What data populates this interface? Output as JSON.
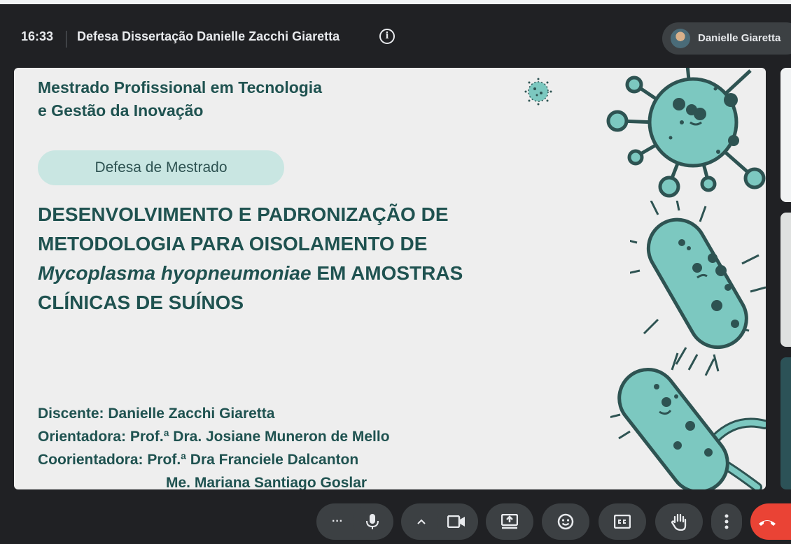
{
  "header": {
    "time": "16:33",
    "meeting_title": "Defesa Dissertação Danielle Zacchi Giaretta",
    "info_glyph": "i",
    "presenter_name": "Danielle Giaretta"
  },
  "slide": {
    "program_line1": "Mestrado Profissional em Tecnologia",
    "program_line2": "e Gestão da Inovação",
    "badge": "Defesa de Mestrado",
    "title_line1": "DESENVOLVIMENTO E PADRONIZAÇÃO DE",
    "title_line2": "METODOLOGIA PARA OISOLAMENTO DE",
    "title_italic": "Mycoplasma hyopneumoniae",
    "title_line3_rest": " EM AMOSTRAS",
    "title_line4": "CLÍNICAS DE SUÍNOS",
    "student": "Discente: Danielle Zacchi Giaretta",
    "advisor": "Orientadora: Prof.ª Dra. Josiane Muneron de Mello",
    "coadvisor": "Coorientadora: Prof.ª Dra Franciele Dalcanton",
    "coadvisor2": "Me. Mariana Santiago Goslar"
  },
  "controls": {
    "more_glyph": "···",
    "caret_glyph": "^",
    "icons": [
      "more-options-icon",
      "microphone-icon",
      "chevron-up-icon",
      "camera-icon",
      "present-screen-icon",
      "emoji-icon",
      "captions-icon",
      "raise-hand-icon",
      "more-vert-icon",
      "end-call-icon"
    ]
  },
  "colors": {
    "background": "#202124",
    "slide_bg": "#eeeeee",
    "slide_text": "#1f5250",
    "badge_bg": "#c9e6e2",
    "germ_fill": "#7cc8c0",
    "germ_stroke": "#2e5352",
    "end_call": "#ea4335"
  }
}
